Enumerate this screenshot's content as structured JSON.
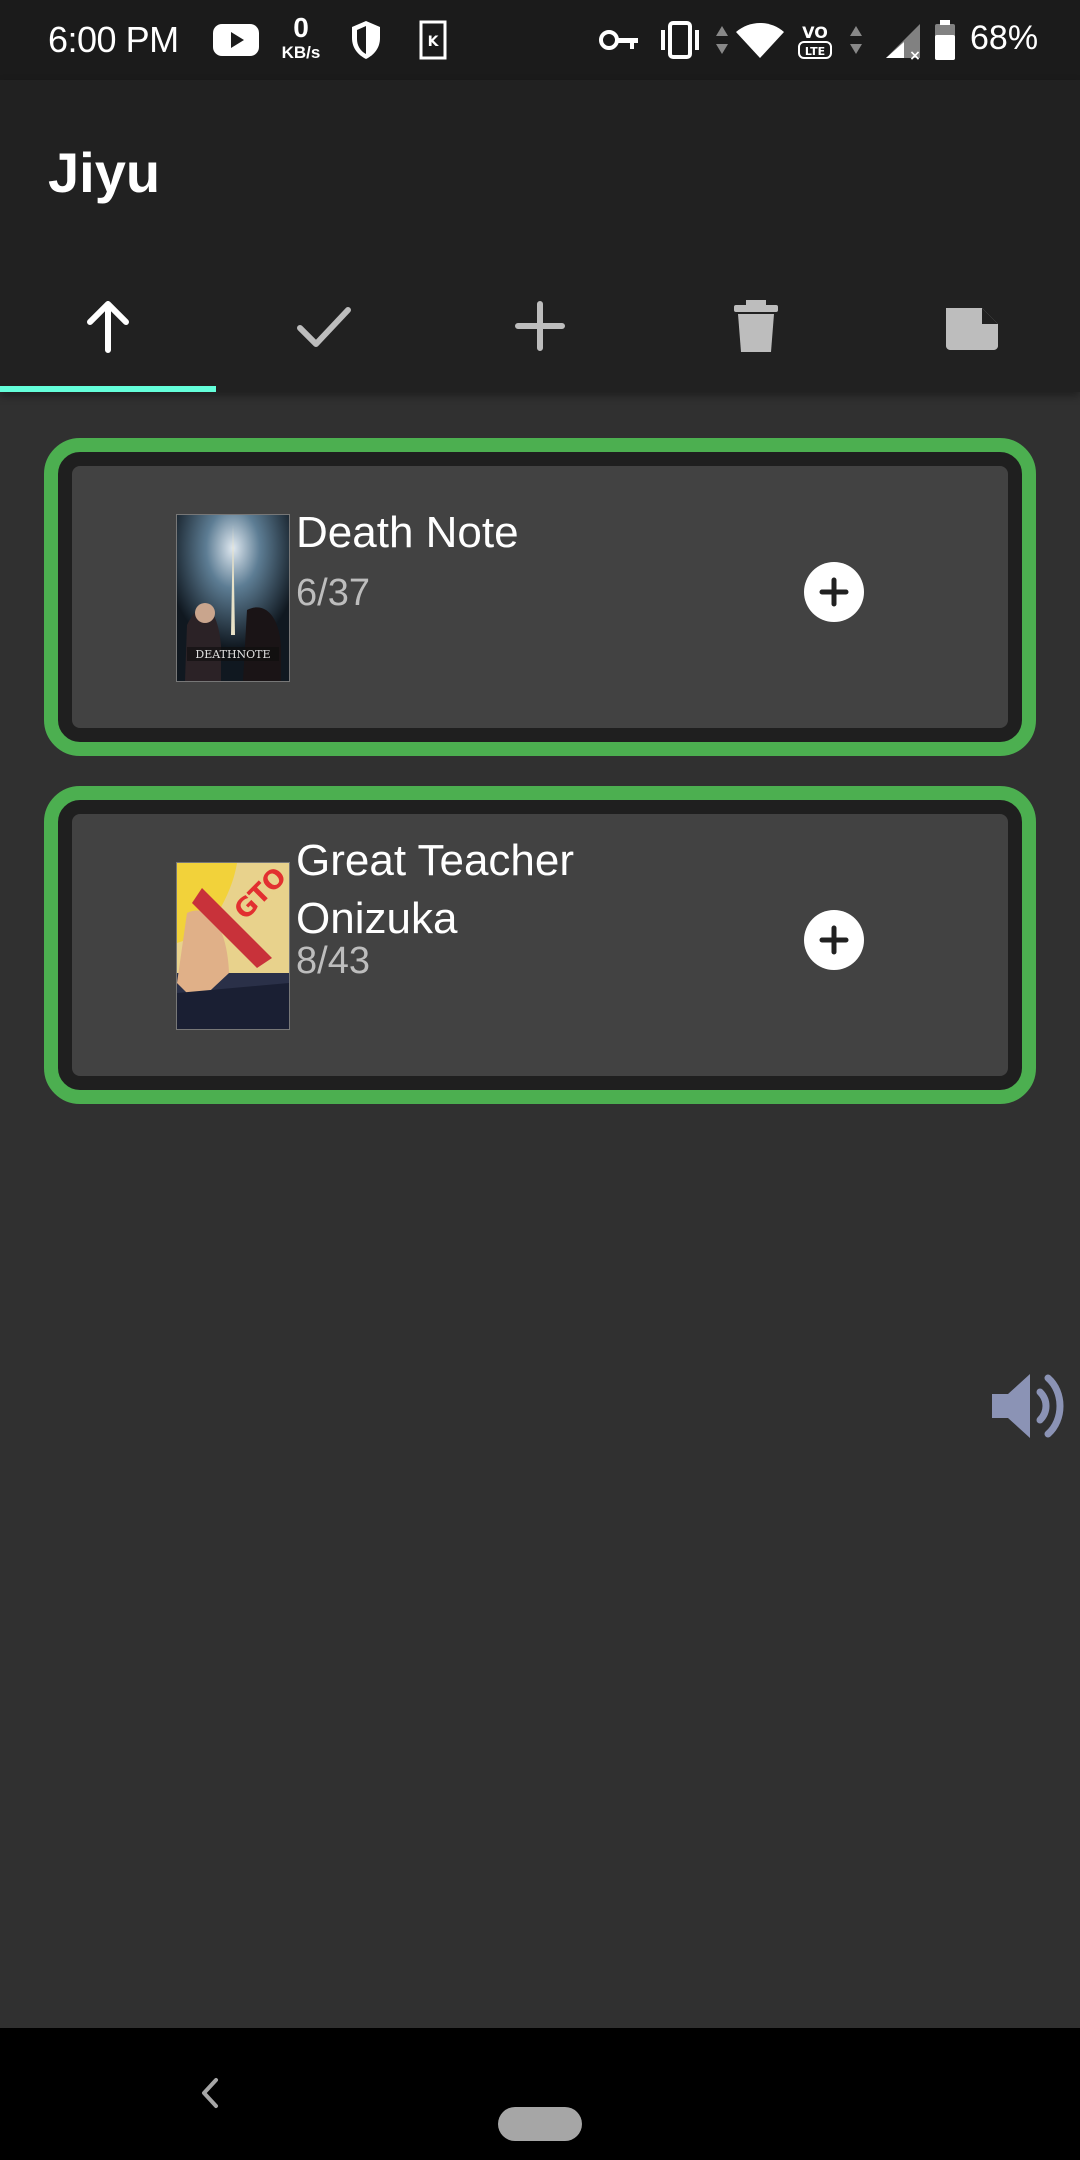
{
  "status_bar": {
    "time": "6:00 PM",
    "net_speed_value": "0",
    "net_speed_unit": "KB/s",
    "battery_percent": "68%",
    "icons": [
      "youtube-icon",
      "shield-icon",
      "k-app-icon",
      "vpn-key-icon",
      "vibrate-icon",
      "wifi-icon",
      "volte-icon",
      "signal-icon",
      "battery-icon"
    ]
  },
  "app_bar": {
    "title": "Jiyu",
    "tabs": [
      {
        "name": "arrow-up-icon",
        "active": true
      },
      {
        "name": "check-icon",
        "active": false
      },
      {
        "name": "plus-icon",
        "active": false
      },
      {
        "name": "trash-icon",
        "active": false
      },
      {
        "name": "note-icon",
        "active": false
      }
    ],
    "accent_color": "#64ffda"
  },
  "items": [
    {
      "title": "Death Note",
      "progress": "6/37",
      "cover_icon": "death-note-cover"
    },
    {
      "title": "Great Teacher Onizuka",
      "progress": "8/43",
      "cover_icon": "gto-cover"
    }
  ],
  "colors": {
    "card_border": "#4caf50",
    "card_bg": "#424242",
    "background": "#303030"
  }
}
